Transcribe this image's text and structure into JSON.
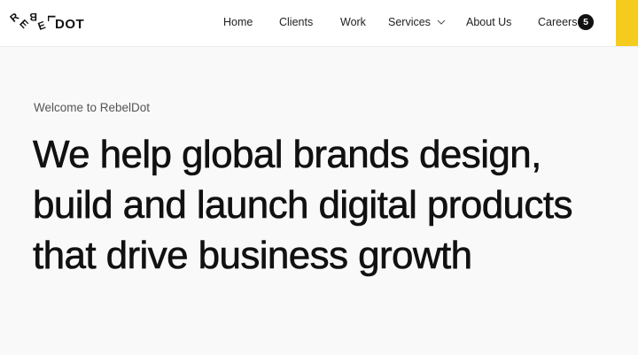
{
  "header": {
    "logo": {
      "letters_top": [
        "R",
        "E",
        "B",
        "E",
        "L"
      ],
      "text": "DOT"
    },
    "nav": [
      {
        "label": "Home"
      },
      {
        "label": "Clients"
      },
      {
        "label": "Work"
      },
      {
        "label": "Services",
        "icon": "chevron-down-icon"
      },
      {
        "label": "About Us"
      },
      {
        "label": "Careers",
        "badge": "5"
      }
    ],
    "accent_color": "#f5cc1d"
  },
  "hero": {
    "eyebrow": "Welcome to RebelDot",
    "headline_lines": [
      "We help global brands design,",
      "build and launch digital products",
      "that drive business growth"
    ]
  }
}
